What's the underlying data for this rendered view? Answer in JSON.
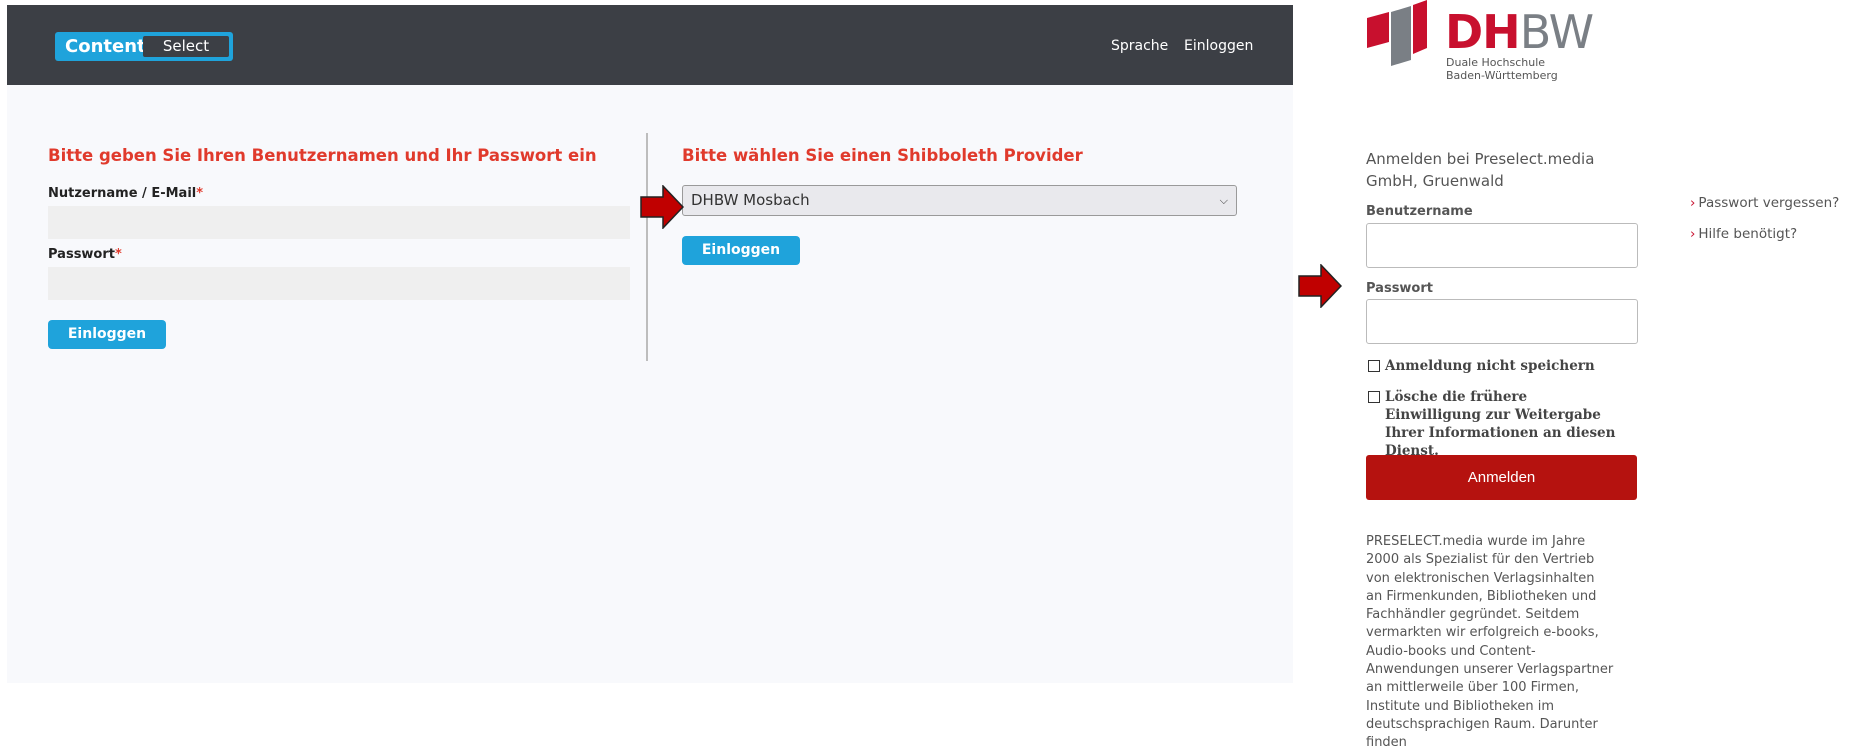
{
  "contentselect": {
    "logo": {
      "part1": "Content",
      "part2": "Select"
    },
    "nav": {
      "language": "Sprache",
      "login": "Einloggen"
    },
    "login_form": {
      "title": "Bitte geben Sie Ihren Benutzernamen und Ihr Passwort ein",
      "username_label": "Nutzername / E-Mail",
      "password_label": "Passwort",
      "required_mark": "*",
      "username_value": "",
      "password_value": "",
      "submit_label": "Einloggen"
    },
    "shibboleth": {
      "title": "Bitte wählen Sie einen Shibboleth Provider",
      "selected_provider": "DHBW Mosbach",
      "submit_label": "Einloggen"
    }
  },
  "idp": {
    "logo": {
      "letters_red": "DH",
      "letters_grey": "BW",
      "line1": "Duale Hochschule",
      "line2": "Baden-Württemberg"
    },
    "intro": "Anmelden bei Preselect.media GmbH, Gruenwald",
    "username_label": "Benutzername",
    "password_label": "Passwort",
    "username_value": "",
    "password_value": "",
    "checkbox_dont_save": "Anmeldung nicht speichern",
    "checkbox_revoke": "Lösche die frühere Einwilligung zur Weitergabe Ihrer Informationen an diesen Dienst.",
    "submit_label": "Anmelden",
    "description": "PRESELECT.media wurde im Jahre 2000 als Spezialist für den Vertrieb von elektronischen Verlagsinhalten an Firmenkunden, Bibliotheken und Fachhändler gegründet. Seitdem vermarkten wir erfolgreich e-books, Audio-books und Content-Anwendungen unserer Verlagspartner an mittlerweile über 100 Firmen, Institute und Bibliotheken im deutschsprachigen Raum. Darunter finden",
    "links": {
      "forgot_password": "Passwort vergessen?",
      "help": "Hilfe benötigt?",
      "chevron": "›"
    }
  },
  "colors": {
    "header_bg": "#3c3f45",
    "accent_blue": "#1fa3db",
    "title_red": "#e03a2c",
    "dhbw_red": "#c8102e",
    "button_red": "#b5120f",
    "annotation_arrow": "#c00000"
  }
}
